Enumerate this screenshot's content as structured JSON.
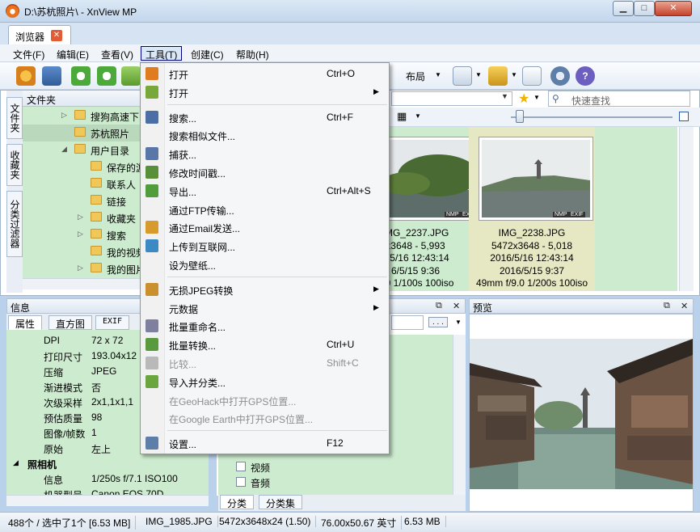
{
  "window": {
    "title": "D:\\苏杭照片\\ - XnView MP",
    "min_glyph": "▁",
    "max_glyph": "□",
    "close_glyph": "✕"
  },
  "tab": {
    "label": "浏览器",
    "close_glyph": "✕"
  },
  "menubar": [
    "文件(F)",
    "编辑(E)",
    "查看(V)",
    "工具(T)",
    "创建(C)",
    "帮助(H)"
  ],
  "toolbar": {
    "layout_label": "布局"
  },
  "vtabs": [
    "文件夹",
    "收藏夹",
    "分类过滤器"
  ],
  "folders": {
    "header": "文件夹",
    "items": [
      {
        "label": "搜狗高速下",
        "indent": 2,
        "expander": "▷"
      },
      {
        "label": "苏杭照片",
        "indent": 2,
        "expander": ""
      },
      {
        "label": "用户目录",
        "indent": 2,
        "expander": "◢"
      },
      {
        "label": "保存的游",
        "indent": 3,
        "expander": ""
      },
      {
        "label": "联系人",
        "indent": 3,
        "expander": ""
      },
      {
        "label": "链接",
        "indent": 3,
        "expander": ""
      },
      {
        "label": "收藏夹",
        "indent": 3,
        "expander": "▷"
      },
      {
        "label": "搜索",
        "indent": 3,
        "expander": "▷"
      },
      {
        "label": "我的视频",
        "indent": 3,
        "expander": ""
      },
      {
        "label": "我的图片",
        "indent": 3,
        "expander": "▷"
      }
    ]
  },
  "search": {
    "placeholder": "快速查找"
  },
  "thumbnails": [
    {
      "name": "IMG_2237.JPG",
      "dims": "x3648 - 5,993",
      "date1": "6/5/16 12:43:14",
      "date2": "6/5/15 9:36",
      "exif": "9.0 1/100s 100iso",
      "selected": false
    },
    {
      "name": "IMG_2238.JPG",
      "dims": "5472x3648 - 5,018",
      "date1": "2016/5/16 12:43:14",
      "date2": "2016/5/15 9:37",
      "exif": "49mm f/9.0 1/200s 100iso",
      "selected": true
    }
  ],
  "badges": [
    "NMP",
    "EXIF"
  ],
  "info": {
    "title": "信息",
    "tabs": [
      "属性",
      "直方图",
      "EXIF"
    ],
    "rows": [
      {
        "key": "DPI",
        "value": "72 x 72"
      },
      {
        "key": "打印尺寸",
        "value": "193.04x12"
      },
      {
        "key": "压缩",
        "value": "JPEG"
      },
      {
        "key": "渐进模式",
        "value": "否"
      },
      {
        "key": "次级采样",
        "value": "2x1,1x1,1"
      },
      {
        "key": "预估质量",
        "value": "98"
      },
      {
        "key": "图像/帧数",
        "value": "1"
      },
      {
        "key": "原始",
        "value": "左上"
      }
    ],
    "section": "照相机",
    "section_rows": [
      {
        "key": "信息",
        "value": "1/250s f/7.1 ISO100"
      },
      {
        "key": "机器型号",
        "value": "Canon EOS 70D"
      }
    ]
  },
  "categories": {
    "ellipsis": ". . .",
    "items": [
      "视频",
      "音频"
    ],
    "tabs": [
      "分类",
      "分类集"
    ]
  },
  "preview": {
    "title": "预览"
  },
  "status": {
    "count": "488个 / 选中了1个 [6.53 MB]",
    "file": "IMG_1985.JPG",
    "dims": "5472x3648x24 (1.50)",
    "print": "76.00x50.67 英寸",
    "size": "6.53 MB"
  },
  "tools_menu": {
    "items": [
      {
        "label": "打开",
        "shortcut": "Ctrl+O",
        "submenu": false,
        "disabled": false,
        "icon": "open-icon",
        "color": "#e07b1f"
      },
      {
        "label": "打开",
        "shortcut": "",
        "submenu": true,
        "disabled": false,
        "icon": "open-with-icon",
        "color": "#79a83a"
      },
      {
        "sep": true
      },
      {
        "label": "搜索...",
        "shortcut": "Ctrl+F",
        "submenu": false,
        "disabled": false,
        "icon": "binoculars-icon",
        "color": "#4b6fa5"
      },
      {
        "label": "搜索相似文件...",
        "shortcut": "",
        "submenu": false,
        "disabled": false,
        "icon": "",
        "color": ""
      },
      {
        "label": "捕获...",
        "shortcut": "",
        "submenu": false,
        "disabled": false,
        "icon": "camera-icon",
        "color": "#5877a8"
      },
      {
        "label": "修改时间戳...",
        "shortcut": "",
        "submenu": false,
        "disabled": false,
        "icon": "clock-icon",
        "color": "#5a8f3a"
      },
      {
        "label": "导出...",
        "shortcut": "Ctrl+Alt+S",
        "submenu": false,
        "disabled": false,
        "icon": "export-icon",
        "color": "#4f9d3c"
      },
      {
        "label": "通过FTP传输...",
        "shortcut": "",
        "submenu": false,
        "disabled": false,
        "icon": "",
        "color": ""
      },
      {
        "label": "通过Email发送...",
        "shortcut": "",
        "submenu": false,
        "disabled": false,
        "icon": "email-icon",
        "color": "#d79a2c"
      },
      {
        "label": "上传到互联网...",
        "shortcut": "",
        "submenu": false,
        "disabled": false,
        "icon": "globe-icon",
        "color": "#3c8ac4"
      },
      {
        "label": "设为壁纸...",
        "shortcut": "",
        "submenu": false,
        "disabled": false,
        "icon": "",
        "color": ""
      },
      {
        "sep": true
      },
      {
        "label": "无损JPEG转换",
        "shortcut": "",
        "submenu": true,
        "disabled": false,
        "icon": "jpeg-transform-icon",
        "color": "#c9902d"
      },
      {
        "label": "元数据",
        "shortcut": "",
        "submenu": true,
        "disabled": false,
        "icon": "",
        "color": ""
      },
      {
        "label": "批量重命名...",
        "shortcut": "",
        "submenu": false,
        "disabled": false,
        "icon": "rename-icon",
        "color": "#7f7f9f"
      },
      {
        "label": "批量转换...",
        "shortcut": "Ctrl+U",
        "submenu": false,
        "disabled": false,
        "icon": "batch-convert-icon",
        "color": "#5a9a3e"
      },
      {
        "label": "比较...",
        "shortcut": "Shift+C",
        "submenu": false,
        "disabled": true,
        "icon": "compare-icon",
        "color": "#b9b9b9"
      },
      {
        "label": "导入并分类...",
        "shortcut": "",
        "submenu": false,
        "disabled": false,
        "icon": "import-icon",
        "color": "#6aa53f"
      },
      {
        "label": "在GeoHack中打开GPS位置...",
        "shortcut": "",
        "submenu": false,
        "disabled": true,
        "icon": "",
        "color": ""
      },
      {
        "label": "在Google Earth中打开GPS位置...",
        "shortcut": "",
        "submenu": false,
        "disabled": true,
        "icon": "",
        "color": ""
      },
      {
        "sep": true
      },
      {
        "label": "设置...",
        "shortcut": "F12",
        "submenu": false,
        "disabled": false,
        "icon": "gear-icon",
        "color": "#5d7ea8"
      }
    ]
  },
  "colors": {
    "accent": "#000080",
    "green_bg": "#cdeccf",
    "selected_thumb": "#e6e8c4"
  }
}
